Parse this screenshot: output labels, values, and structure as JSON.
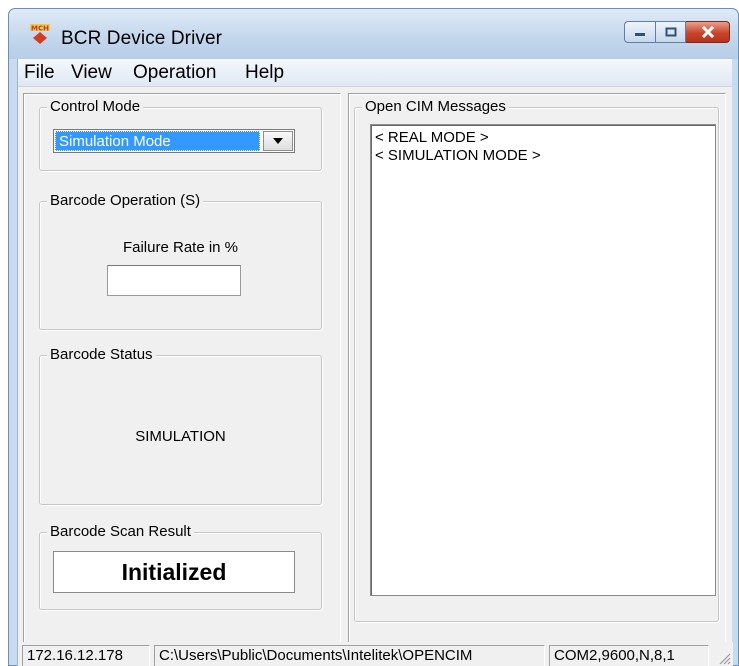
{
  "window": {
    "title": "BCR Device Driver",
    "icon": "app-logo-icon",
    "controls": {
      "minimize": "minimize-icon",
      "maximize": "maximize-icon",
      "close": "close-icon"
    }
  },
  "menu": [
    {
      "label": "File"
    },
    {
      "label": "View"
    },
    {
      "label": "Operation"
    },
    {
      "label": "Help"
    }
  ],
  "control_mode": {
    "label": "Control Mode",
    "selected": "Simulation Mode",
    "arrow_icon": "dropdown-arrow-icon"
  },
  "barcode_operation": {
    "label": "Barcode Operation (S)",
    "failure_rate_label": "Failure Rate in %",
    "failure_rate_value": ""
  },
  "barcode_status": {
    "label": "Barcode Status",
    "value": "SIMULATION"
  },
  "barcode_scan_result": {
    "label": "Barcode Scan Result",
    "value": "Initialized"
  },
  "messages": {
    "label": "Open CIM Messages",
    "items": [
      "< REAL MODE >",
      "< SIMULATION MODE >"
    ]
  },
  "statusbar": {
    "ip": "172.16.12.178",
    "path": "C:\\Users\\Public\\Documents\\Intelitek\\OPENCIM",
    "port": "COM2,9600,N,8,1",
    "grip_icon": "resize-grip-icon"
  },
  "colors": {
    "selection": "#3399ff",
    "close_button": "#c8452b",
    "titlebar": "#c2d6ec"
  }
}
